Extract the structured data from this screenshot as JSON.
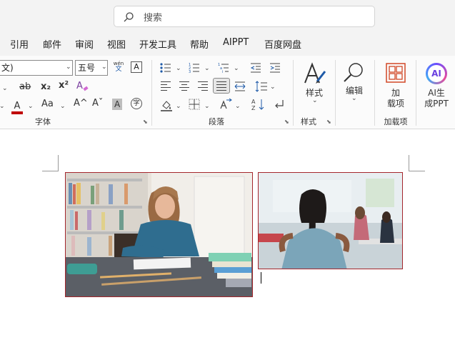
{
  "search": {
    "placeholder": "搜索"
  },
  "menu": {
    "items": [
      "引用",
      "邮件",
      "审阅",
      "视图",
      "开发工具",
      "帮助",
      "AIPPT",
      "百度网盘"
    ]
  },
  "font_group": {
    "font_name": "文)",
    "font_size": "五号",
    "phonetic_top": "wén",
    "phonetic_bottom": "文",
    "border_char": "A",
    "strike": "ab",
    "subscript": "x₂",
    "superscript": "x²",
    "font_color_letter": "A",
    "grow": "A^",
    "shrink": "Aˇ",
    "case": "Aa",
    "shade": "A",
    "enclose": "字",
    "label": "字体",
    "accent_red": "#c00000"
  },
  "paragraph_group": {
    "label": "段落"
  },
  "styles_group": {
    "button_label": "样式",
    "label": "样式"
  },
  "edit_group": {
    "button_label": "编辑"
  },
  "addins_group": {
    "button_line1": "加",
    "button_line2": "载项",
    "label": "加载项"
  },
  "ai_group": {
    "icon_text": "AI",
    "line1": "AI生",
    "line2": "成PPT"
  }
}
